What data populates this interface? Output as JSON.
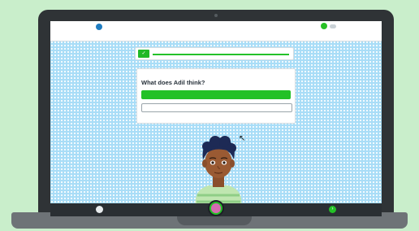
{
  "header": {
    "logo_text": "",
    "right_text": "",
    "back_link": ""
  },
  "progress": {
    "title": "",
    "subtitle": "",
    "value": 1.0
  },
  "question": {
    "title": "What does Adil think?",
    "options": [
      {
        "label": ""
      },
      {
        "label": ""
      }
    ]
  },
  "bottom_bar": {
    "left_label": "",
    "right_label": ""
  },
  "colors": {
    "accent_green": "#23c126",
    "brand_blue": "#1f7dc1",
    "background_blue": "#a9ddf7",
    "laptop_frame": "#2f3336"
  }
}
